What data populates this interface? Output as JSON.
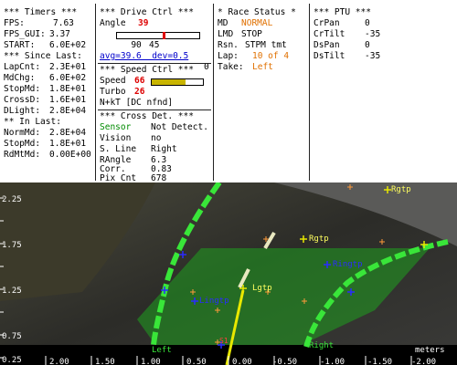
{
  "timers": {
    "title": "*** Timers ***",
    "fps_label": "FPS:",
    "fps_value": "7.63",
    "fps_gui_label": "FPS_GUI:",
    "fps_gui_value": "3.37",
    "start_label": "START:",
    "start_value": "6.0E+02",
    "since_title": "*** Since Last:",
    "lapcnt_label": "LapCnt:",
    "lapcnt_value": "2.3E+01",
    "mdchg_label": "MdChg:",
    "mdchg_value": "6.0E+02",
    "stopmd_label": "StopMd:",
    "stopmd_value": "1.8E+01",
    "crossd_label": "CrossD:",
    "crossd_value": "1.6E+01",
    "dlight_label": "DLight:",
    "dlight_value": "2.8E+04",
    "in_last_title": "** In Last:",
    "normmd_label": "NormMd:",
    "normmd_value": "2.8E+04",
    "stopmd2_label": "StopMd:",
    "stopmd2_value": "1.8E+01",
    "rdmtmd_label": "RdMtMd:",
    "rdmtmd_value": "0.00E+00"
  },
  "drive": {
    "title": "*** Drive Ctrl ***",
    "angle_label": "Angle",
    "angle_value": "39",
    "slider_min": "90",
    "slider_max": "0",
    "slider_mid": "45",
    "slider_fraction": 0.57,
    "avg_dev": "avg=39.6  dev=0.5",
    "speed_title": "*** Speed Ctrl ***",
    "speed_label": "Speed",
    "speed_value": "66",
    "speed_fraction": 0.66,
    "turbo_label": "Turbo",
    "turbo_value": "26",
    "nkt": "N+kT [DC nfnd]",
    "cross_title": "*** Cross Det. ***",
    "sensor_label": "Sensor",
    "sensor_value": "Not Detect.",
    "vision_label": "Vision",
    "vision_value": "no",
    "sline_label": "S. Line",
    "sline_value": "Right",
    "rangle_label": "RAngle",
    "rangle_value": "6.3",
    "corr_label": "Corr.",
    "corr_value": "0.83",
    "pixcnt_label": "Pix Cnt",
    "pixcnt_value": "678"
  },
  "race": {
    "title": "* Race Status *",
    "md_label": "MD",
    "md_value": "NORMAL",
    "lmd_label": "LMD",
    "lmd_value": "STOP",
    "rsn_label": "Rsn.",
    "rsn_value": "STPM tmt",
    "lap_label": "Lap:",
    "lap_value": "10 of 4",
    "take_label": "Take:",
    "take_value": "Left"
  },
  "ptu": {
    "title": "*** PTU ***",
    "crpan_label": "CrPan",
    "crpan_value": "0",
    "crtilt_label": "CrTilt",
    "crtilt_value": "-35",
    "dspan_label": "DsPan",
    "dspan_value": "0",
    "dstilt_label": "DsTilt",
    "dstilt_value": "-35"
  },
  "view": {
    "y_ticks": [
      "2.25",
      "1.75",
      "1.25",
      "0.75",
      "0.25"
    ],
    "x_ticks": [
      "2.00",
      "1.50",
      "1.00",
      "0.50",
      "0.00",
      "-0.50",
      "-1.00",
      "-1.50",
      "-2.00"
    ],
    "units": "meters",
    "rgtp_top": "Rgtp",
    "rgtp_mid": "Rgtp",
    "ringtp": "Ringtp",
    "lgtp": "Lgtp",
    "lingtp": "Lingtp",
    "left_label": "Left",
    "right_label": "Right",
    "marker_label": "S1",
    "colors": {
      "overlay": "#1fa01f",
      "line": "#39e639",
      "target": "#e8e800",
      "cross": "#2b2bff"
    }
  }
}
